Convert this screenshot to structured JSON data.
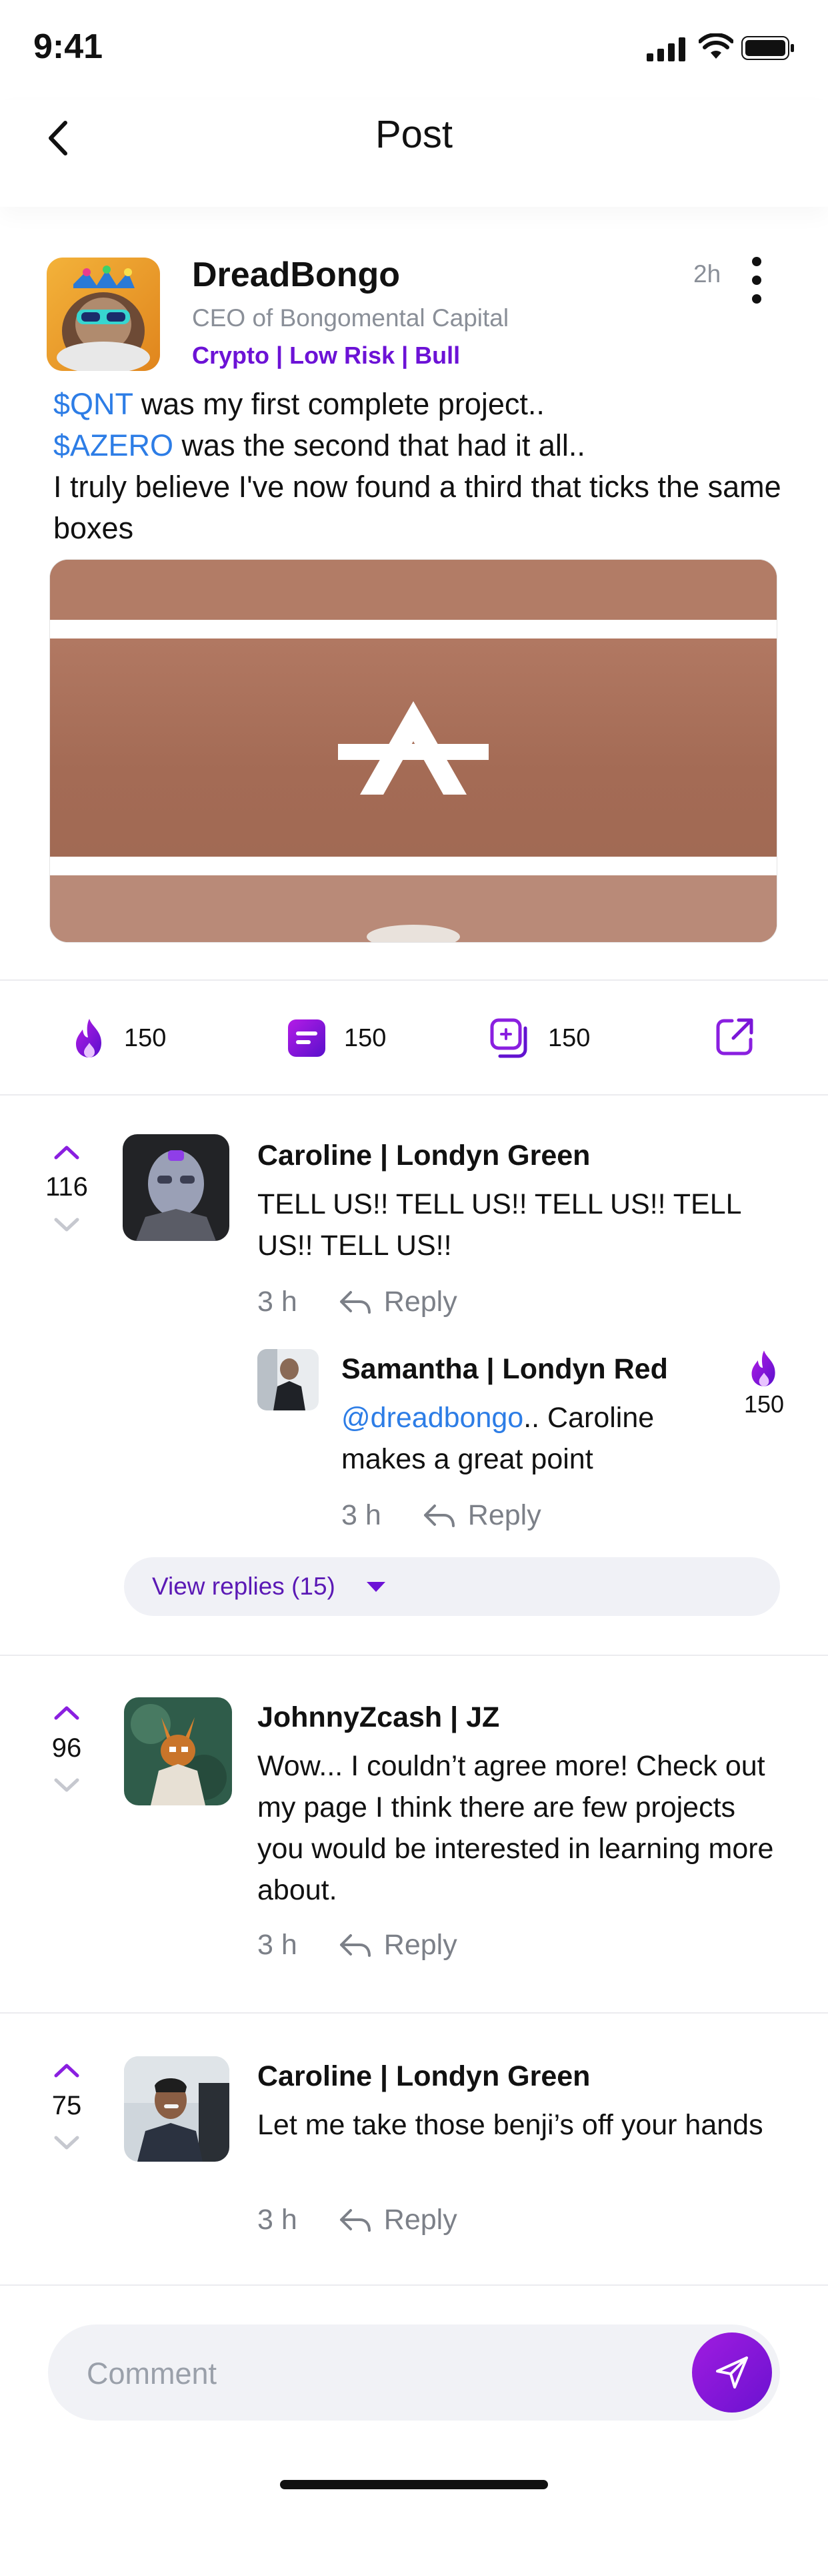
{
  "status_bar": {
    "time": "9:41"
  },
  "header": {
    "title": "Post"
  },
  "post": {
    "author": "DreadBongo",
    "subtitle": "CEO of Bongomental Capital",
    "tags": "Crypto | Low Risk | Bull",
    "time": "2h",
    "ticker1": "$QNT",
    "line1_rest": " was my first complete project..",
    "ticker2": "$AZERO",
    "line2_rest": " was the second that had it all..",
    "line3": "I truly believe I've now found a third that ticks the same boxes"
  },
  "stats": {
    "fire": "150",
    "comments": "150",
    "reposts": "150"
  },
  "comments": [
    {
      "name": "Caroline  |  Londyn Green",
      "text": "TELL US!! TELL US!! TELL US!! TELL US!! TELL US!!",
      "time": "3 h",
      "reply_label": "Reply",
      "votes": "116"
    },
    {
      "name": "JohnnyZcash  |  JZ",
      "text": "Wow... I couldn’t agree more! Check out my page I think there are few projects you would be interested in learning more about.",
      "time": "3 h",
      "reply_label": "Reply",
      "votes": "96"
    },
    {
      "name": "Caroline  |  Londyn Green",
      "text": "Let me take those benji’s off your hands",
      "time": "3 h",
      "reply_label": "Reply",
      "votes": "75"
    }
  ],
  "nested_reply": {
    "name": "Samantha  |  Londyn Red",
    "mention": "@dreadbongo",
    "text_rest": ".. Caroline makes a great point",
    "time": "3 h",
    "reply_label": "Reply",
    "fire_count": "150"
  },
  "view_replies": {
    "label": "View replies (15)"
  },
  "composer": {
    "placeholder": "Comment"
  },
  "colors": {
    "accent": "#6c12d6",
    "link": "#2d7de6",
    "muted": "#8a8f98"
  }
}
